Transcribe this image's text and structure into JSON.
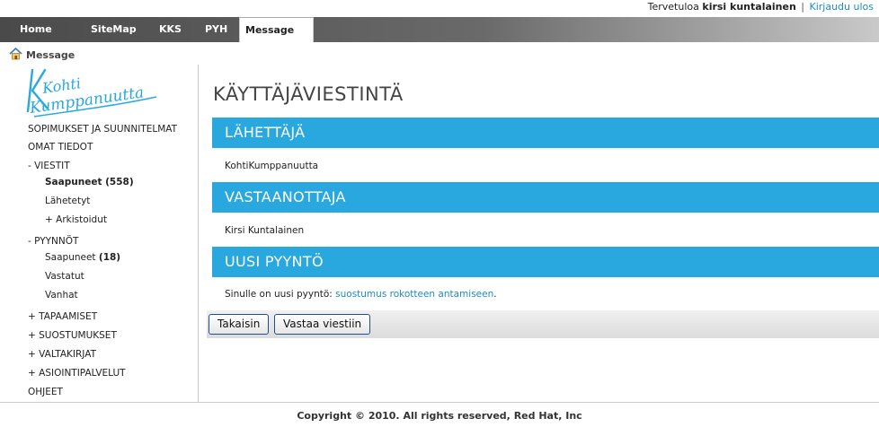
{
  "header": {
    "welcome_prefix": "Tervetuloa",
    "user_name": "kirsi kuntalainen",
    "separator": "|",
    "logout": "Kirjaudu ulos"
  },
  "nav": {
    "tabs": [
      "Home",
      "SiteMap",
      "KKS",
      "PYH",
      "Message"
    ],
    "active": "Message"
  },
  "breadcrumb": {
    "label": "Message",
    "icon": "home-icon"
  },
  "sidebar": {
    "logo_text": [
      "Kohti",
      "Kumppanuutta"
    ],
    "items": [
      {
        "label": "SOPIMUKSET JA SUUNNITELMAT"
      },
      {
        "label": "OMAT TIEDOT"
      },
      {
        "label": "-  VIESTIT"
      },
      {
        "label": "Saapuneet",
        "count": "(558)"
      },
      {
        "label": "Lähetetyt"
      },
      {
        "label": "+ Arkistoidut"
      },
      {
        "label": "-  PYYNNÖT"
      },
      {
        "label": "Saapuneet",
        "count": "(18)"
      },
      {
        "label": "Vastatut"
      },
      {
        "label": "Vanhat"
      },
      {
        "label": "+ TAPAAMISET"
      },
      {
        "label": "+ SUOSTUMUKSET"
      },
      {
        "label": "+ VALTAKIRJAT"
      },
      {
        "label": "+ ASIOINTIPALVELUT"
      },
      {
        "label": "OHJEET"
      }
    ]
  },
  "main": {
    "title": "KÄYTTÄJÄVIESTINTÄ",
    "sender_heading": "LÄHETTÄJÄ",
    "sender_value": "KohtiKumppanuutta",
    "recipient_heading": "VASTAANOTTAJA",
    "recipient_value": "Kirsi Kuntalainen",
    "request_heading": "UUSI PYYNTÖ",
    "request_text_prefix": "Sinulle on uusi pyyntö: ",
    "request_link": "suostumus rokotteen antamiseen",
    "request_text_suffix": ".",
    "buttons": {
      "back": "Takaisin",
      "reply": "Vastaa viestiin"
    }
  },
  "footer": {
    "copyright": "Copyright © 2010. All rights reserved, Red Hat, Inc"
  },
  "colors": {
    "band": "#29a8df",
    "link": "#1a8cc9",
    "nav_dark": "#4a4a4a"
  }
}
